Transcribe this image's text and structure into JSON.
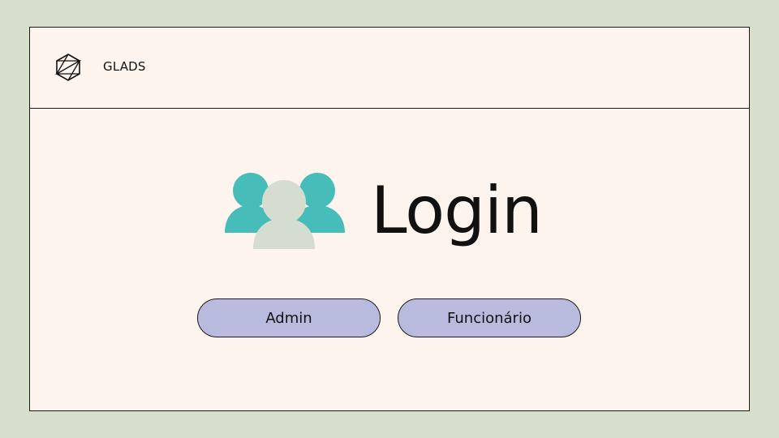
{
  "header": {
    "brand": "GLADS",
    "logo_icon": "hexagon-logo-icon"
  },
  "main": {
    "title": "Login",
    "hero_icon": "users-group-icon",
    "buttons": [
      {
        "label": "Admin"
      },
      {
        "label": "Funcionário"
      }
    ]
  },
  "colors": {
    "background": "#d5dfcb",
    "card": "#fdf4ee",
    "accent_teal": "#46bdb9",
    "user_front": "#d4ddd0",
    "button": "#b9bbde"
  }
}
